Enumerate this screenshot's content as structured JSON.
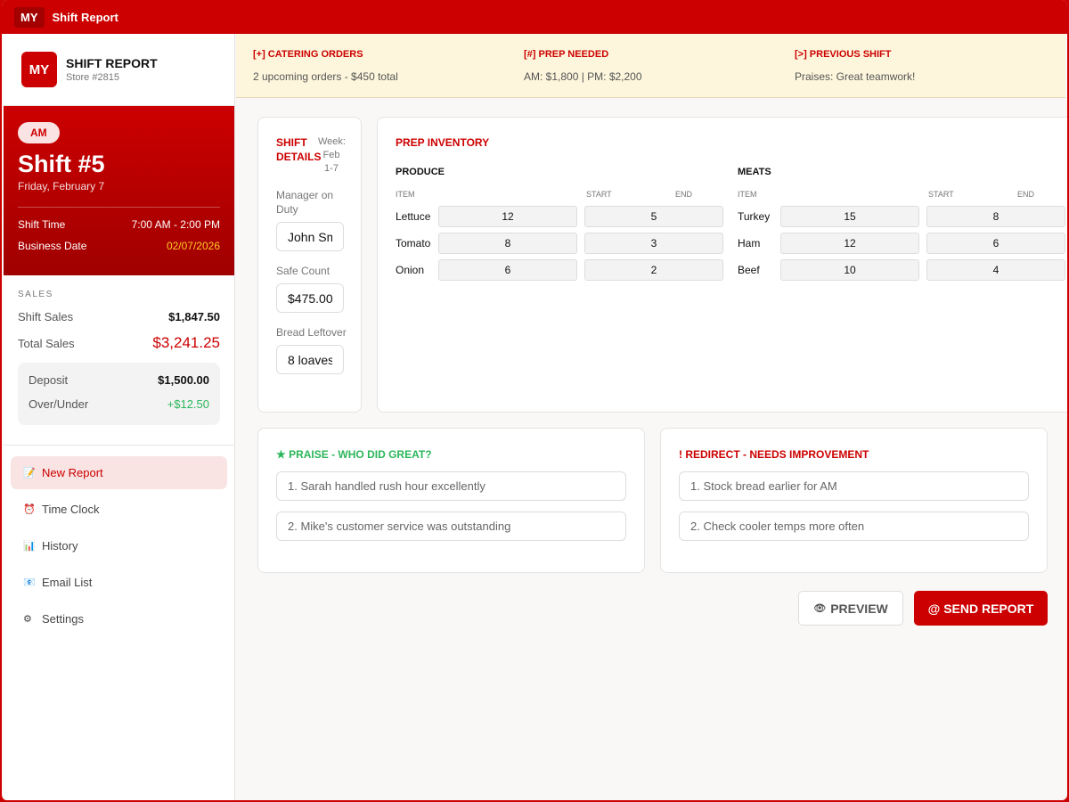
{
  "titlebar": {
    "logo": "MY",
    "title": "Shift Report"
  },
  "brand": {
    "logo": "MY",
    "title": "SHIFT REPORT",
    "store": "Store #2815"
  },
  "shift": {
    "badge": "AM",
    "title": "Shift #5",
    "date": "Friday, February 7",
    "time_label": "Shift Time",
    "time_value": "7:00 AM - 2:00 PM",
    "bizdate_label": "Business Date",
    "bizdate_value": "02/07/2026"
  },
  "sales": {
    "heading": "SALES",
    "shift_label": "Shift Sales",
    "shift_value": "$1,847.50",
    "total_label": "Total Sales",
    "total_value": "$3,241.25",
    "deposit_label": "Deposit",
    "deposit_value": "$1,500.00",
    "overunder_label": "Over/Under",
    "overunder_value": "+$12.50"
  },
  "nav": [
    {
      "icon": "memo",
      "label": "New Report",
      "active": true
    },
    {
      "icon": "alarm-clock",
      "label": "Time Clock"
    },
    {
      "icon": "bar-chart",
      "label": "History"
    },
    {
      "icon": "email",
      "label": "Email List"
    },
    {
      "icon": "gear",
      "label": "Settings"
    }
  ],
  "banner": [
    {
      "title": "[+] CATERING ORDERS",
      "text": "2 upcoming orders - $450 total"
    },
    {
      "title": "[#] PREP NEEDED",
      "text": "AM: $1,800 | PM: $2,200"
    },
    {
      "title": "[>] PREVIOUS SHIFT",
      "text": "Praises: Great teamwork!"
    }
  ],
  "details": {
    "title": "SHIFT DETAILS",
    "week": "Week: Feb 1-7",
    "manager_label": "Manager on Duty",
    "manager_value": "John Sm",
    "safe_label": "Safe Count",
    "safe_value": "$475.00",
    "bread_label": "Bread Leftover",
    "bread_value": "8 loaves"
  },
  "inventory": {
    "title": "PREP INVENTORY",
    "col_item": "ITEM",
    "col_start": "START",
    "col_end": "END",
    "produce": {
      "title": "PRODUCE",
      "rows": [
        {
          "item": "Lettuce",
          "start": "12",
          "end": "5"
        },
        {
          "item": "Tomato",
          "start": "8",
          "end": "3"
        },
        {
          "item": "Onion",
          "start": "6",
          "end": "2"
        }
      ]
    },
    "meats": {
      "title": "MEATS",
      "rows": [
        {
          "item": "Turkey",
          "start": "15",
          "end": "8"
        },
        {
          "item": "Ham",
          "start": "12",
          "end": "6"
        },
        {
          "item": "Beef",
          "start": "10",
          "end": "4"
        }
      ]
    }
  },
  "praise": {
    "title": "★ PRAISE - WHO DID GREAT?",
    "items": [
      "1. Sarah handled rush hour excellently",
      "2. Mike's customer service was outstanding"
    ]
  },
  "redirect": {
    "title": "! REDIRECT - NEEDS IMPROVEMENT",
    "items": [
      "1. Stock bread earlier for AM",
      "2. Check cooler temps more often"
    ]
  },
  "actions": {
    "preview": "PREVIEW",
    "send": "@ SEND REPORT"
  },
  "colors": {
    "accent": "#cc0000",
    "positive": "#2bb65a",
    "highlight": "#ffc928"
  }
}
